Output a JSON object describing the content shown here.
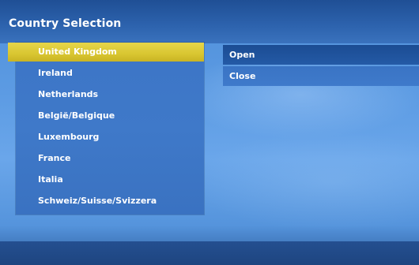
{
  "window": {
    "title": "Country Selection"
  },
  "country_list": {
    "selected_index": 0,
    "items": [
      {
        "label": "United Kingdom"
      },
      {
        "label": "Ireland"
      },
      {
        "label": "Netherlands"
      },
      {
        "label": "België/Belgique"
      },
      {
        "label": "Luxembourg"
      },
      {
        "label": "France"
      },
      {
        "label": "Italia"
      },
      {
        "label": "Schweiz/Suisse/Svizzera"
      }
    ]
  },
  "actions": {
    "open_label": "Open",
    "close_label": "Close"
  },
  "colors": {
    "selection_highlight": "#d9c631",
    "focused_action": "#1b4c93",
    "panel_blue": "#3c75c6",
    "title_bar": "#2d63ae",
    "text": "#ffffff"
  }
}
